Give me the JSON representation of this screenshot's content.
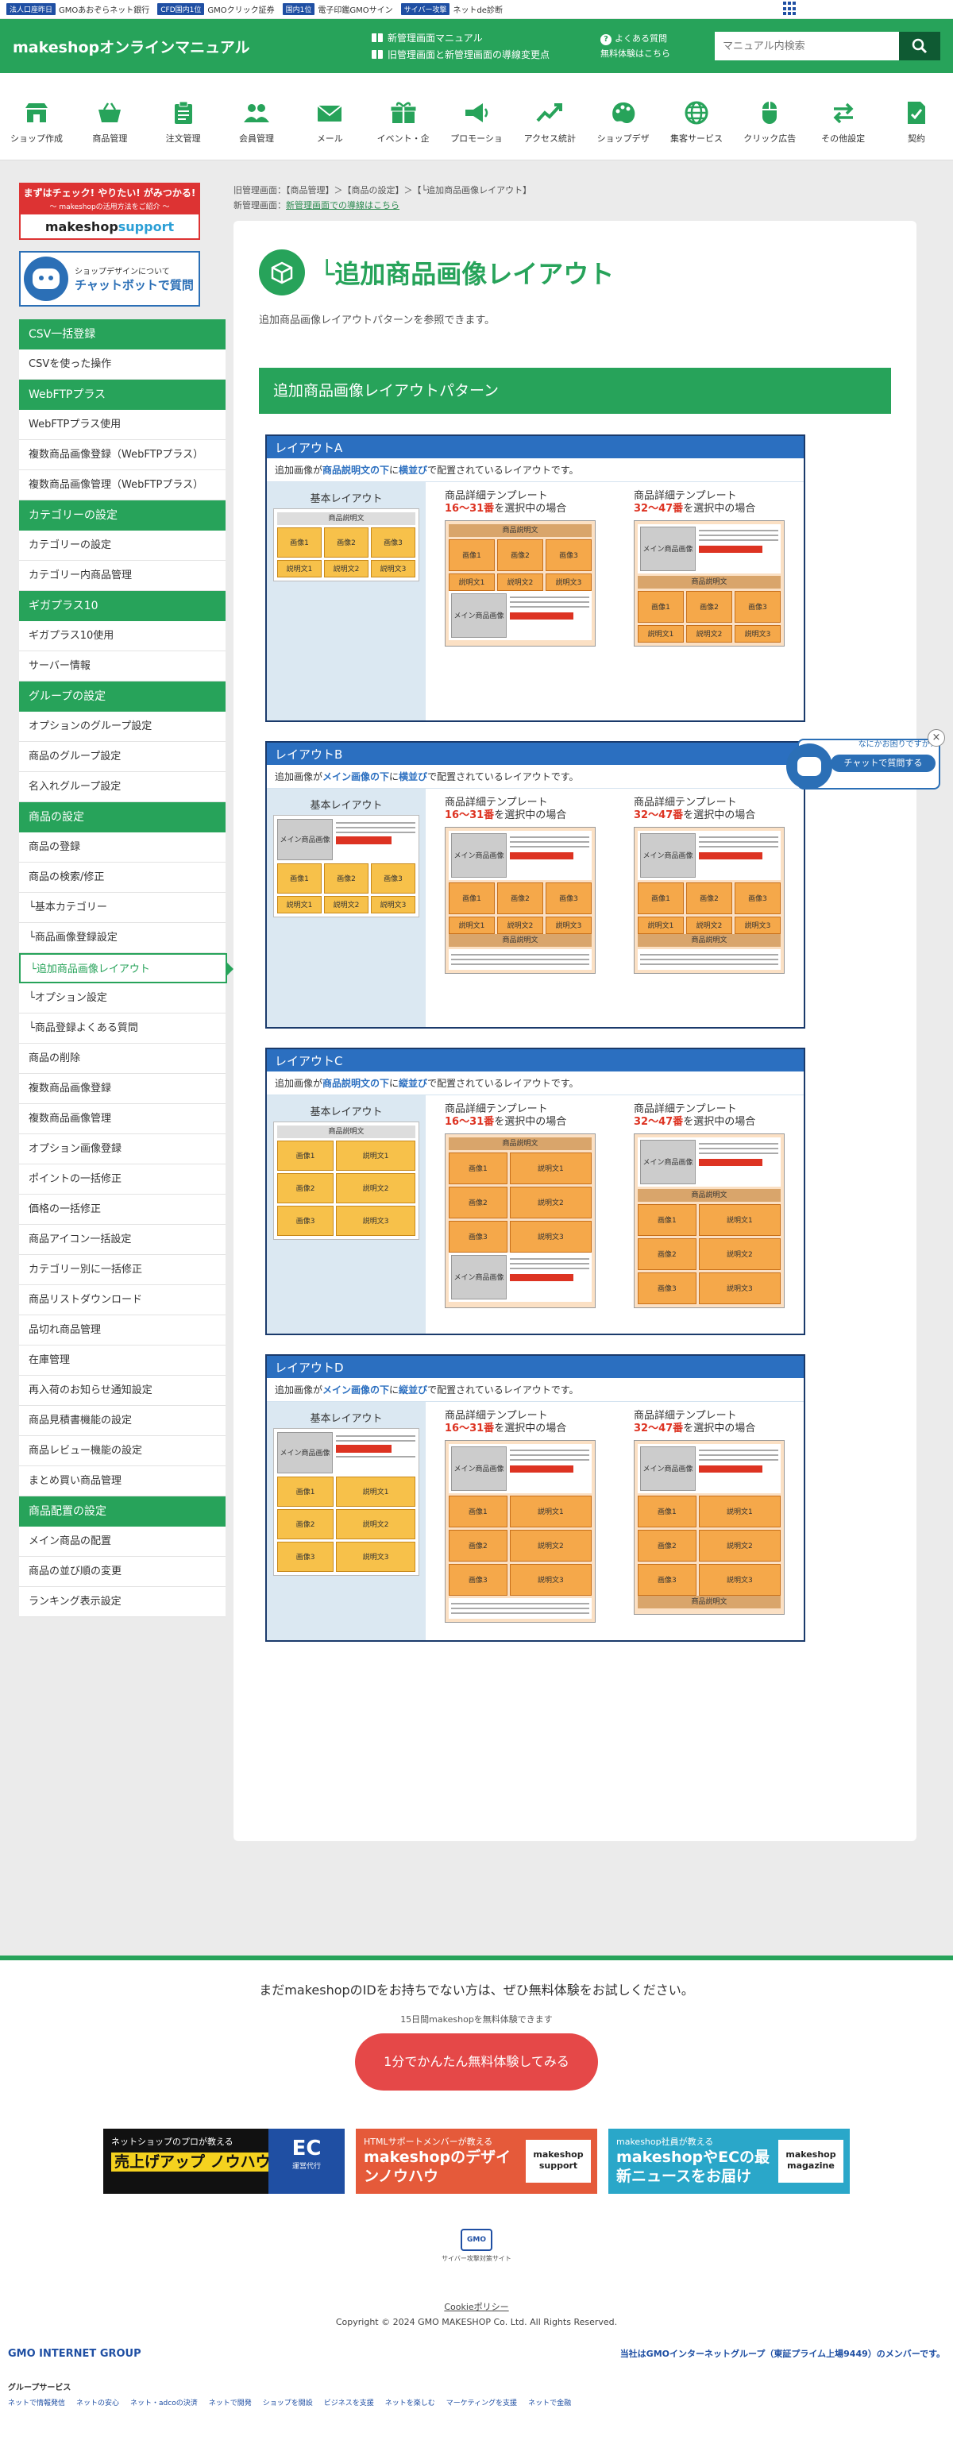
{
  "gmobar": {
    "items": [
      {
        "badge": "法人口座昨日",
        "label": "GMOあおぞらネット銀行"
      },
      {
        "badge": "CFD国内1位",
        "label": "GMOクリック証券"
      },
      {
        "badge": "国内1位",
        "label": "電子印鑑GMOサイン"
      },
      {
        "badge": "サイバー攻撃",
        "label": "ネットde診断"
      }
    ]
  },
  "header": {
    "logo": "makeshopオンラインマニュアル",
    "link1": "新管理画面マニュアル",
    "link2": "旧管理画面と新管理画面の導線変更点",
    "faq": "よくある質問",
    "trial": "無料体験はこちら",
    "search_placeholder": "マニュアル内検索"
  },
  "nav": [
    {
      "label": "ショップ作成",
      "icon": "shop-icon"
    },
    {
      "label": "商品管理",
      "icon": "basket-icon"
    },
    {
      "label": "注文管理",
      "icon": "clipboard-icon"
    },
    {
      "label": "会員管理",
      "icon": "members-icon"
    },
    {
      "label": "メール",
      "icon": "mail-icon"
    },
    {
      "label": "イベント・企",
      "icon": "gift-icon"
    },
    {
      "label": "プロモーショ",
      "icon": "megaphone-icon"
    },
    {
      "label": "アクセス統計",
      "icon": "chart-icon"
    },
    {
      "label": "ショップデザ",
      "icon": "palette-icon"
    },
    {
      "label": "集客サービス",
      "icon": "globe-icon"
    },
    {
      "label": "クリック広告",
      "icon": "mouse-icon"
    },
    {
      "label": "その他設定",
      "icon": "arrows-icon"
    },
    {
      "label": "契約",
      "icon": "contract-icon"
    }
  ],
  "banners": {
    "b1_top": "まずはチェック! やりたい! がみつかる!",
    "b1_sub": "〜 makeshopの活用方法をご紹介 〜",
    "b1_logo": "makeshop",
    "b1_logo2": "support",
    "b2_top": "ショップデザインについて",
    "b2_main": "チャットボットで質問"
  },
  "menu": [
    {
      "type": "sec",
      "label": "CSV一括登録"
    },
    {
      "type": "it",
      "label": "CSVを使った操作"
    },
    {
      "type": "sec",
      "label": "WebFTPプラス"
    },
    {
      "type": "it",
      "label": "WebFTPプラス使用"
    },
    {
      "type": "it",
      "label": "複数商品画像登録（WebFTPプラス）"
    },
    {
      "type": "it",
      "label": "複数商品画像管理（WebFTPプラス）"
    },
    {
      "type": "sec",
      "label": "カテゴリーの設定"
    },
    {
      "type": "it",
      "label": "カテゴリーの設定"
    },
    {
      "type": "it",
      "label": "カテゴリー内商品管理"
    },
    {
      "type": "sec",
      "label": "ギガプラス10"
    },
    {
      "type": "it",
      "label": "ギガプラス10使用"
    },
    {
      "type": "it",
      "label": "サーバー情報"
    },
    {
      "type": "sec",
      "label": "グループの設定"
    },
    {
      "type": "it",
      "label": "オプションのグループ設定"
    },
    {
      "type": "it",
      "label": "商品のグループ設定"
    },
    {
      "type": "it",
      "label": "名入れグループ設定"
    },
    {
      "type": "sec",
      "label": "商品の設定"
    },
    {
      "type": "it",
      "label": "商品の登録"
    },
    {
      "type": "it",
      "label": "商品の検索/修正"
    },
    {
      "type": "it",
      "label": "└基本カテゴリー"
    },
    {
      "type": "it",
      "label": "└商品画像登録設定"
    },
    {
      "type": "active",
      "label": "└追加商品画像レイアウト"
    },
    {
      "type": "it",
      "label": "└オプション設定"
    },
    {
      "type": "it",
      "label": "└商品登録よくある質問"
    },
    {
      "type": "it",
      "label": "商品の削除"
    },
    {
      "type": "it",
      "label": "複数商品画像登録"
    },
    {
      "type": "it",
      "label": "複数商品画像管理"
    },
    {
      "type": "it",
      "label": "オプション画像登録"
    },
    {
      "type": "it",
      "label": "ポイントの一括修正"
    },
    {
      "type": "it",
      "label": "価格の一括修正"
    },
    {
      "type": "it",
      "label": "商品アイコン一括設定"
    },
    {
      "type": "it",
      "label": "カテゴリー別に一括修正"
    },
    {
      "type": "it",
      "label": "商品リストダウンロード"
    },
    {
      "type": "it",
      "label": "品切れ商品管理"
    },
    {
      "type": "it",
      "label": "在庫管理"
    },
    {
      "type": "it",
      "label": "再入荷のお知らせ通知設定"
    },
    {
      "type": "it",
      "label": "商品見積書機能の設定"
    },
    {
      "type": "it",
      "label": "商品レビュー機能の設定"
    },
    {
      "type": "it",
      "label": "まとめ買い商品管理"
    },
    {
      "type": "sec",
      "label": "商品配置の設定"
    },
    {
      "type": "it",
      "label": "メイン商品の配置"
    },
    {
      "type": "it",
      "label": "商品の並び順の変更"
    },
    {
      "type": "it",
      "label": "ランキング表示設定"
    }
  ],
  "breadcrumb": {
    "old": "旧管理画面：【商品管理】＞【商品の設定】＞【└追加商品画像レイアウト】",
    "new_prefix": "新管理画面：",
    "new_link": "新管理画面での導線はこちら"
  },
  "main": {
    "title": "└追加商品画像レイアウト",
    "desc": "追加商品画像レイアウトパターンを参照できます。",
    "section": "追加商品画像レイアウトパターン"
  },
  "common": {
    "basic": "基本レイアウト",
    "tmpl_title": "商品詳細テンプレート",
    "t1": "16～31番",
    "t2": "32～47番",
    "suffix": "を選択中の場合",
    "desc_text": "商品説明文",
    "main_image": "メイン商品画像",
    "img1": "画像1",
    "img2": "画像2",
    "img3": "画像3",
    "d1": "説明文1",
    "d2": "説明文2",
    "d3": "説明文3"
  },
  "layouts": [
    {
      "name": "レイアウトA",
      "pre": "追加画像が",
      "hl": "商品説明文の下",
      "mid": "に",
      "hl2": "横並び",
      "post": "で配置されているレイアウトです。"
    },
    {
      "name": "レイアウトB",
      "pre": "追加画像が",
      "hl": "メイン画像の下",
      "mid": "に",
      "hl2": "横並び",
      "post": "で配置されているレイアウトです。"
    },
    {
      "name": "レイアウトC",
      "pre": "追加画像が",
      "hl": "商品説明文の下",
      "mid": "に",
      "hl2": "縦並び",
      "post": "で配置されているレイアウトです。"
    },
    {
      "name": "レイアウトD",
      "pre": "追加画像が",
      "hl": "メイン画像の下",
      "mid": "に",
      "hl2": "縦並び",
      "post": "で配置されているレイアウトです。"
    }
  ],
  "chat": {
    "question": "なにかお困りですか?",
    "button": "チャットで質問する",
    "close": "×"
  },
  "footer": {
    "question": "まだmakeshopのIDをお持ちでない方は、ぜひ無料体験をお試しください。",
    "note": "15日間makeshopを無料体験できます",
    "cta": "1分でかんたん無料体験してみる",
    "b1_a": "ネットショップのプロが教える",
    "b1_b": "売上げアップ ノウハウ",
    "b1_ec": "EC",
    "b1_ec_sub": "運営代行",
    "b2_a": "HTMLサポートメンバーが教える",
    "b2_b": "makeshopのデザインノウハウ",
    "b2_logo": "makeshop support",
    "b3_a": "makeshop社員が教える",
    "b3_b": "makeshopやECの最新ニュースをお届け",
    "b3_logo": "makeshop magazine",
    "secu1": "GMO",
    "secu2": "サイバー攻撃対策サイト",
    "cookie": "Cookieポリシー",
    "copyright": "Copyright © 2024 GMO MAKESHOP Co. Ltd. All Rights Reserved.",
    "gmo_logo": "GMO INTERNET GROUP",
    "gmo_member": "当社はGMOインターネットグループ（東証プライム上場9449）のメンバーです。",
    "gs_head": "グループサービス",
    "gs_links": [
      "ネットで情報発信",
      "ネットの安心",
      "ネット・adcoの決済",
      "ネットで開発",
      "ショップを開設",
      "ビジネスを支援",
      "ネットを楽しむ",
      "マーケティングを支援",
      "ネットで金融"
    ]
  },
  "colors": {
    "brand_green": "#27a35a",
    "layout_blue": "#2b6fc0",
    "cta_red": "#e54848"
  }
}
